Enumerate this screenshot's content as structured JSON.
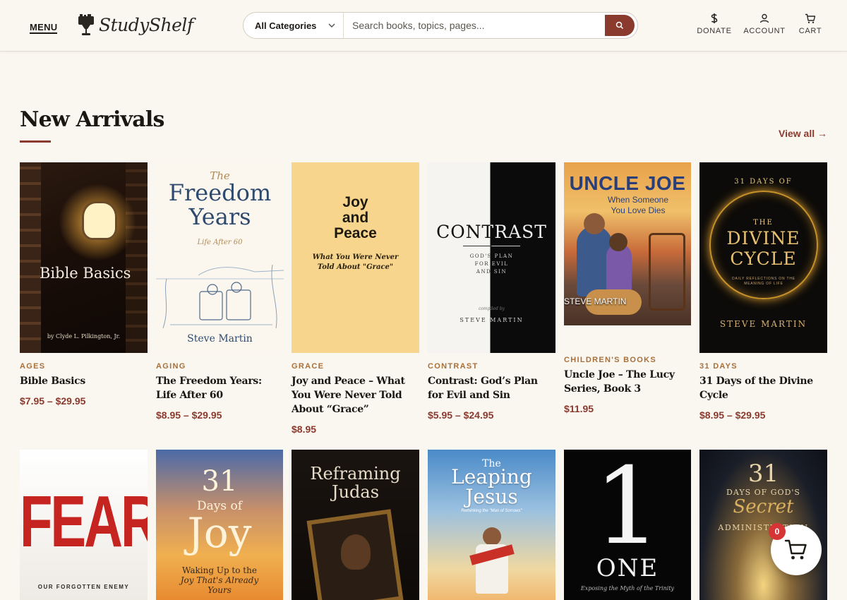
{
  "header": {
    "menu_label": "MENU",
    "logo_text": "StudyShelf",
    "category_select": "All Categories",
    "search_placeholder": "Search books, topics, pages...",
    "nav": [
      {
        "label": "DONATE",
        "icon": "dollar-icon"
      },
      {
        "label": "ACCOUNT",
        "icon": "user-icon"
      },
      {
        "label": "CART",
        "icon": "cart-icon"
      }
    ]
  },
  "section": {
    "title": "New Arrivals",
    "view_all": "View all →"
  },
  "products": [
    {
      "category": "AGES",
      "title": "Bible Basics",
      "price": "$7.95 – $29.95",
      "cover": {
        "title": "Bible Basics",
        "author": "by Clyde L. Pilkington, Jr."
      }
    },
    {
      "category": "AGING",
      "title": "The Freedom Years: Life After 60",
      "price": "$8.95 – $29.95",
      "cover": {
        "pre": "The",
        "title1": "Freedom",
        "title2": "Years",
        "subtitle": "Life After 60",
        "author": "Steve Martin"
      }
    },
    {
      "category": "GRACE",
      "title": "Joy and Peace – What You Were Never Told About “Grace”",
      "price": "$8.95",
      "cover": {
        "title1": "Joy",
        "title2": "and",
        "title3": "Peace",
        "subtitle": "What You Were Never Told About \"Grace\""
      }
    },
    {
      "category": "CONTRAST",
      "title": "Contrast: God’s Plan for Evil and Sin",
      "price": "$5.95 – $24.95",
      "cover": {
        "title": "CONTRAST",
        "sub1": "GOD'S PLAN",
        "sub2": "FOR EVIL",
        "sub3": "AND SIN",
        "compiled": "compiled by",
        "author": "STEVE MARTIN"
      }
    },
    {
      "category": "CHILDREN'S BOOKS",
      "title": "Uncle Joe – The Lucy Series, Book 3",
      "price": "$11.95",
      "cover": {
        "title": "UNCLE JOE",
        "sub1": "When Someone",
        "sub2": "You Love Dies",
        "author": "STEVE MARTIN"
      }
    },
    {
      "category": "31 DAYS",
      "title": "31 Days of the Divine Cycle",
      "price": "$8.95 – $29.95",
      "cover": {
        "top": "31 DAYS OF",
        "the": "THE",
        "title1": "DIVINE",
        "title2": "CYCLE",
        "sub": "DAILY REFLECTIONS ON THE MEANING OF LIFE",
        "author": "STEVE MARTIN"
      }
    }
  ],
  "row2_covers": [
    {
      "title": "FEAR",
      "sub": "OUR FORGOTTEN ENEMY"
    },
    {
      "title1": "31",
      "title2": "Days of",
      "title3": "Joy",
      "sub1": "Waking Up to the",
      "sub2": "Joy That's Already",
      "sub3": "Yours"
    },
    {
      "title1": "Reframing",
      "title2": "Judas"
    },
    {
      "pre": "The",
      "title1": "Leaping",
      "title2": "Jesus",
      "sub": "Rethinking the \"Man of Sorrows\""
    },
    {
      "title1": "1",
      "title2": "ONE",
      "sub": "Exposing the Myth of the Trinity"
    },
    {
      "title1": "31",
      "title2": "DAYS OF GOD'S",
      "title3": "Secret",
      "title4": "ADMINISTRATION"
    }
  ],
  "floating_cart": {
    "count": "0"
  },
  "colors": {
    "accent": "#8b3a2e",
    "category": "#a8703a",
    "background": "#faf6f0"
  }
}
